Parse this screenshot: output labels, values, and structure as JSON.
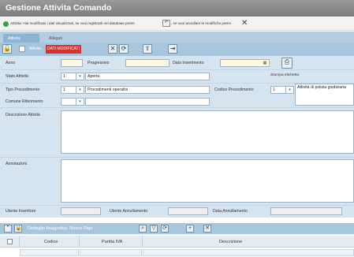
{
  "window": {
    "title": "Gestione Attivita Comando"
  },
  "info": {
    "message": "Attivita: Hai modificato i dati visualizzati, se vuoi registrarli nel database premi",
    "message_suffix": ", se vuoi annullare le modifiche premi",
    "undo_glyph": "↶",
    "close_glyph": "✕"
  },
  "tabs": [
    {
      "label": "Attivita"
    },
    {
      "label": "Allegati"
    }
  ],
  "toolbar": {
    "label": "Attivita",
    "status_badge": "DATI MODIFICATI",
    "icons": [
      "unlock-icon",
      "close-icon",
      "refresh-icon",
      "upload-icon",
      "exit-icon"
    ],
    "glyphs": {
      "cancel": "✕",
      "refresh": "⟳",
      "upload": "⇪",
      "exit": "⇥",
      "lock": "🔓"
    }
  },
  "form": {
    "anno_label": "Anno",
    "progressivo_label": "Progressivo",
    "data_inserimento_label": "Data Inserimento",
    "data_inserimento_value": "",
    "calendar_glyph": "▦",
    "stampa_etichetta_label": "Stampa etichetta",
    "stato_attivita_label": "Stato Attività",
    "stato_attivita_code": "1",
    "stato_attivita_value": "Aperta",
    "tipo_procedimento_label": "Tipo Procedimento",
    "tipo_procedimento_code": "1",
    "tipo_procedimento_value": "Procedimenti operativi",
    "codice_procedimento_label": "Codice Procedimento",
    "codice_procedimento_code": "1",
    "codice_procedimento_value": "Attività di polizia giudiziaria",
    "comune_riferimento_label": "Comune Riferimento",
    "comune_riferimento_code": "",
    "descrizione_label": "Descrizione Attività",
    "annotazioni_label": "Annotazioni",
    "utente_inseritore_label": "Utente Inseritore",
    "utente_annullamento_label": "Utente Annullamento",
    "data_annullamento_label": "Data Annullamento",
    "select_arrow": "▾"
  },
  "grid": {
    "title": "Dettaglio Anagrafica: Nuova Riga",
    "columns": [
      "Codice",
      "Partita IVA",
      "Descrizione"
    ],
    "glyphs": {
      "collapse": "⌃",
      "lock": "🔒",
      "search": "⌕",
      "filter": "▽",
      "refresh": "⟳",
      "add": "+",
      "delete": "✕"
    }
  }
}
